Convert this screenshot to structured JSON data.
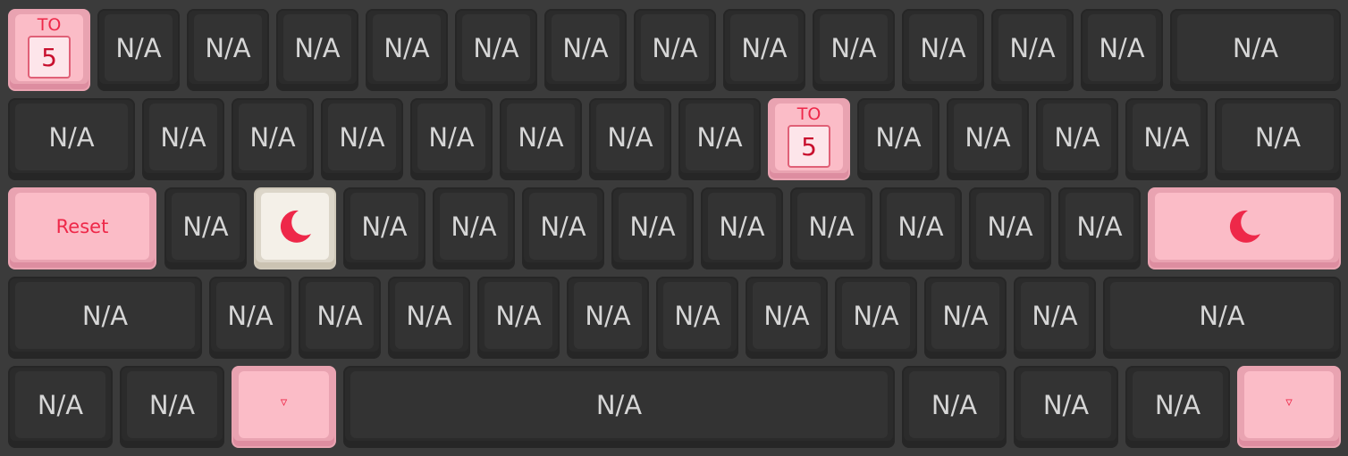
{
  "na": "N/A",
  "to_key": {
    "label": "TO",
    "layer": "5"
  },
  "reset": "Reset",
  "icons": {
    "moon": "moon-icon",
    "trans": "triangle-down-icon"
  },
  "colors": {
    "accent": "#ee2849",
    "pink_key": "#fbbcc7",
    "dark_key": "#333333",
    "cream_key": "#f4f0e8",
    "background": "#3b3b3b"
  }
}
